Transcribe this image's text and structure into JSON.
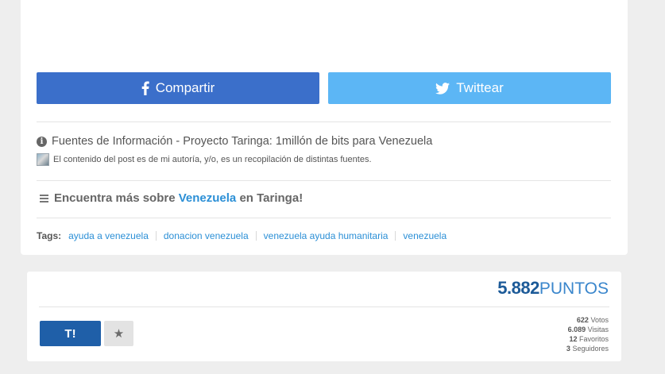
{
  "share": {
    "facebook_label": "Compartir",
    "twitter_label": "Twittear"
  },
  "sources": {
    "title": "Fuentes de Información - Proyecto Taringa: 1millón de bits para Venezuela",
    "author_note": "El contenido del post es de mi autoría, y/o, es un recopilación de distintas fuentes."
  },
  "more": {
    "prefix": "Encuentra más sobre",
    "link": "Venezuela",
    "suffix": "en Taringa!"
  },
  "tags": {
    "label": "Tags:",
    "items": [
      "ayuda a venezuela",
      "donacion venezuela",
      "venezuela ayuda humanitaria",
      "venezuela"
    ]
  },
  "points": {
    "value": "5.882",
    "label": "PUNTOS"
  },
  "actions": {
    "vote_label": "T!",
    "favorite_icon": "star-icon"
  },
  "stats": {
    "votes_value": "622",
    "votes_label": "Votos",
    "visits_value": "6.089",
    "visits_label": "Visitas",
    "favorites_value": "12",
    "favorites_label": "Favoritos",
    "followers_value": "3",
    "followers_label": "Seguidores"
  },
  "colors": {
    "facebook": "#3b6fca",
    "twitter": "#5cb6f5",
    "link": "#2b8fd6",
    "points": "#1c5a98",
    "vote_button": "#1f5fa8"
  }
}
